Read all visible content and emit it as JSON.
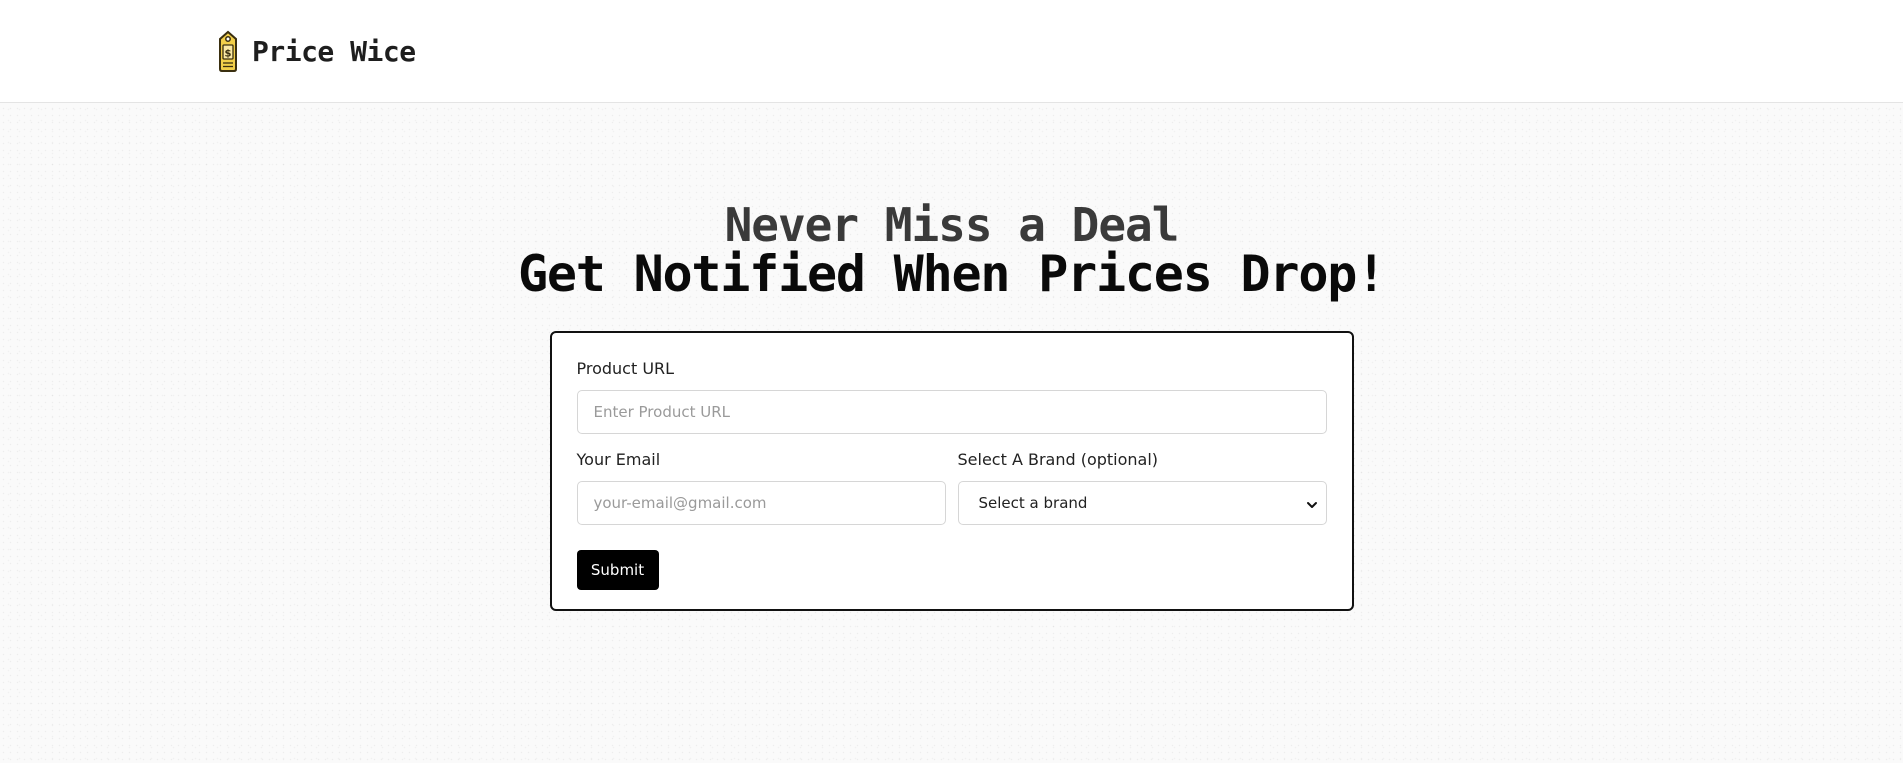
{
  "header": {
    "brand_name": "Price Wice",
    "logo_icon": "price-tag-dollar-icon"
  },
  "hero": {
    "line1": "Never Miss a Deal",
    "line2": "Get Notified When Prices Drop!"
  },
  "form": {
    "product_url_label": "Product URL",
    "product_url_placeholder": "Enter Product URL",
    "product_url_value": "",
    "email_label": "Your Email",
    "email_placeholder": "your-email@gmail.com",
    "email_value": "",
    "brand_label": "Select A Brand (optional)",
    "brand_selected": "Select a brand",
    "submit_label": "Submit"
  },
  "colors": {
    "accent": "#000000",
    "logo_fill": "#f2cf4a",
    "card_border": "#111111"
  }
}
